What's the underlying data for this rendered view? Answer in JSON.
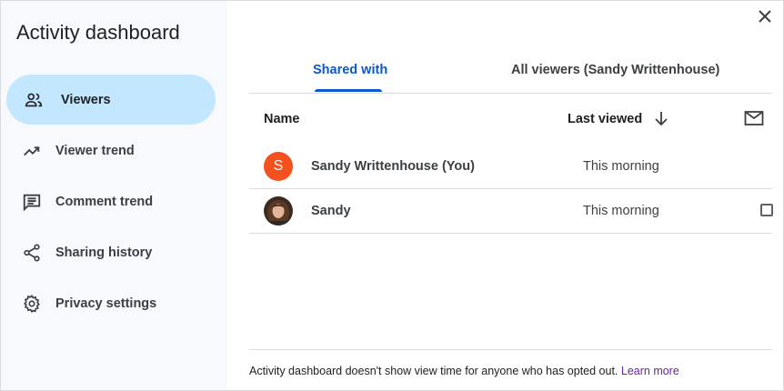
{
  "sidebar": {
    "title": "Activity dashboard",
    "items": [
      {
        "label": "Viewers",
        "icon": "people-icon",
        "active": true
      },
      {
        "label": "Viewer trend",
        "icon": "trending-up-icon"
      },
      {
        "label": "Comment trend",
        "icon": "comment-icon"
      },
      {
        "label": "Sharing history",
        "icon": "share-icon"
      },
      {
        "label": "Privacy settings",
        "icon": "gear-icon"
      }
    ]
  },
  "dialog": {
    "close_icon": "close-icon"
  },
  "tabs": [
    {
      "label": "Shared with",
      "active": true
    },
    {
      "label": "All viewers (Sandy Writtenhouse)"
    }
  ],
  "table": {
    "headers": {
      "name": "Name",
      "last_viewed": "Last viewed",
      "sort_icon": "arrow-down-icon",
      "email_icon": "mail-icon"
    },
    "rows": [
      {
        "avatar_letter": "S",
        "name": "Sandy Writtenhouse (You)",
        "last_viewed": "This morning",
        "avatar_color": "#f4511e"
      },
      {
        "name": "Sandy",
        "last_viewed": "This morning",
        "has_checkbox": true
      }
    ]
  },
  "footer": {
    "text": "Activity dashboard doesn't show view time for anyone who has opted out. ",
    "link": "Learn more"
  },
  "colors": {
    "accent": "#0b57d0",
    "active_nav": "#c2e7ff",
    "link": "#6a1fa6"
  }
}
